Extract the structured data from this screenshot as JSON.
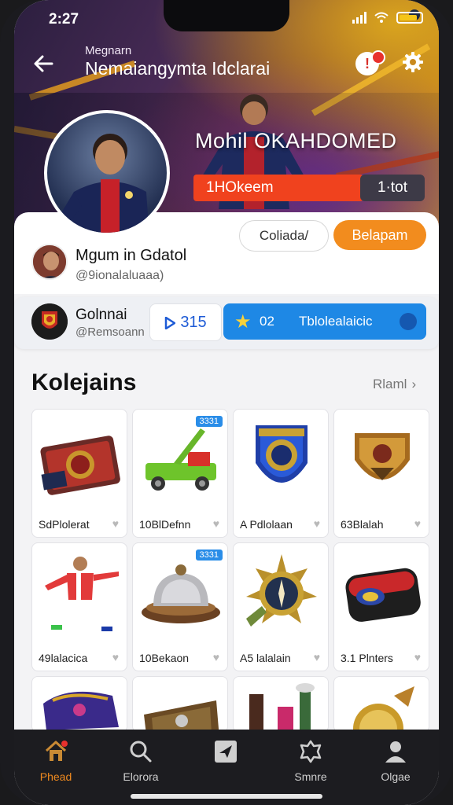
{
  "status_bar": {
    "time": "2:27"
  },
  "header": {
    "subtitle": "Megnarn",
    "title": "Nemaiangymta Idclarai",
    "notification_count": "!"
  },
  "hero": {
    "player_name": "Mohil OKAHDOMED",
    "rank_label": "1HOkeem",
    "rank_count": "1·tot"
  },
  "profile": {
    "name": "Mgum in Gdatol",
    "handle": "@9ionalaluaaa)",
    "outline_button": "Coliada/",
    "primary_button": "Belapam"
  },
  "club": {
    "name": "Golnnai",
    "handle": "@Remsoann",
    "play_count": "315",
    "pill_number": "02",
    "pill_text": "Tblolealaicic"
  },
  "collections": {
    "title": "Kolejains",
    "link": "Rlaml",
    "items": [
      {
        "label": "SdPlolerat",
        "icon": "treasure-chest-icon",
        "badge": ""
      },
      {
        "label": "10BlDefnn",
        "icon": "toy-crane-truck-icon",
        "badge": "3331"
      },
      {
        "label": "A Pdlolaan",
        "icon": "shield-badge-icon",
        "badge": ""
      },
      {
        "label": "63Blalah",
        "icon": "golden-crest-icon",
        "badge": ""
      },
      {
        "label": "49lalacica",
        "icon": "football-player-icon",
        "badge": ""
      },
      {
        "label": "10Bekaon",
        "icon": "bell-dome-icon",
        "badge": "3331"
      },
      {
        "label": "A5 lalalain",
        "icon": "compass-medal-icon",
        "badge": ""
      },
      {
        "label": "3.1 Plnters",
        "icon": "red-case-icon",
        "badge": ""
      },
      {
        "label": "",
        "icon": "purple-cloth-icon",
        "badge": ""
      },
      {
        "label": "",
        "icon": "wooden-frame-icon",
        "badge": ""
      },
      {
        "label": "",
        "icon": "bottles-icon",
        "badge": ""
      },
      {
        "label": "",
        "icon": "golden-ornament-icon",
        "badge": ""
      }
    ]
  },
  "bottom_nav": [
    {
      "label": "Phead",
      "icon": "home-icon",
      "active": true
    },
    {
      "label": "Elorora",
      "icon": "search-icon",
      "active": false
    },
    {
      "label": "",
      "icon": "send-icon",
      "active": false
    },
    {
      "label": "Smnre",
      "icon": "store-icon",
      "active": false
    },
    {
      "label": "Olgae",
      "icon": "profile-icon",
      "active": false
    }
  ],
  "colors": {
    "accent_orange": "#f28c1e",
    "accent_blue": "#1e88e5",
    "rank_red": "#f0421e",
    "nav_bg": "#1c1c20"
  }
}
